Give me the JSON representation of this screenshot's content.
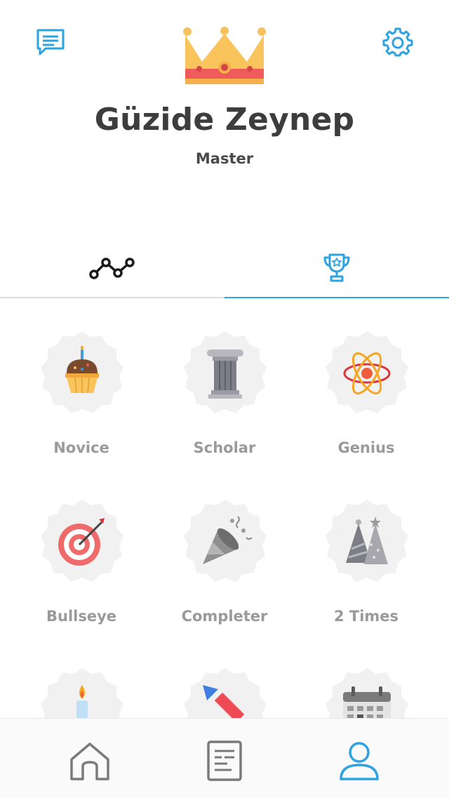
{
  "header": {
    "chat_icon": "chat-bubble-icon",
    "settings_icon": "gear-icon",
    "crown_icon": "crown-icon",
    "accent_color": "#2ea3e2"
  },
  "profile": {
    "name": "Güzide Zeynep",
    "rank": "Master"
  },
  "tabs": [
    {
      "icon": "line-graph-icon",
      "active": false
    },
    {
      "icon": "trophy-icon",
      "active": true
    }
  ],
  "achievements": [
    {
      "label": "Novice",
      "icon": "cupcake-icon"
    },
    {
      "label": "Scholar",
      "icon": "column-icon"
    },
    {
      "label": "Genius",
      "icon": "atom-icon"
    },
    {
      "label": "Bullseye",
      "icon": "target-icon"
    },
    {
      "label": "Completer",
      "icon": "party-popper-icon"
    },
    {
      "label": "2 Times",
      "icon": "party-hats-icon"
    },
    {
      "label": "",
      "icon": "candle-icon"
    },
    {
      "label": "",
      "icon": "firecracker-icon"
    },
    {
      "label": "",
      "icon": "calendar-icon"
    }
  ],
  "bottom_nav": [
    {
      "icon": "home-icon",
      "active": false
    },
    {
      "icon": "notes-icon",
      "active": false
    },
    {
      "icon": "profile-icon",
      "active": true
    }
  ]
}
